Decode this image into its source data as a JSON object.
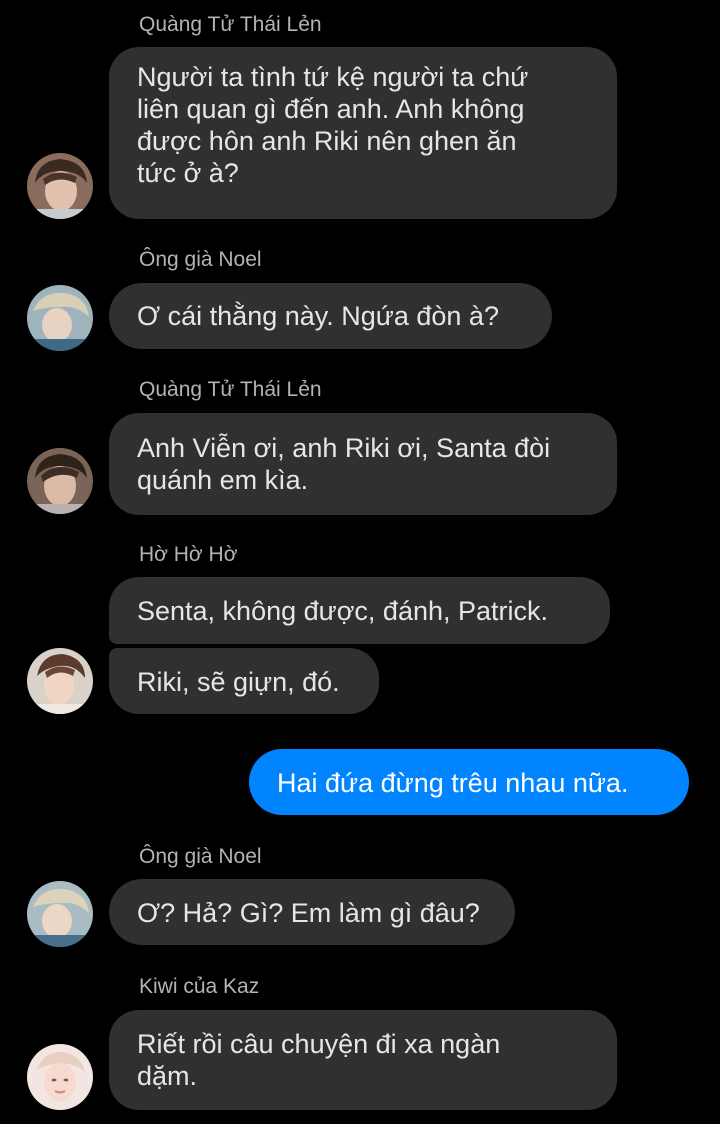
{
  "colors": {
    "background": "#000000",
    "incoming_bubble": "#303030",
    "outgoing_bubble": "#0084ff",
    "sender_name": "#b0b3b8",
    "message_text": "#e4e6eb"
  },
  "messages": [
    {
      "sender": "Quàng Tử Thái Lẻn",
      "text": "Người ta tình tứ kệ người ta chứ\nliên quan gì đến anh. Anh không\nđược hôn anh Riki nên ghen ăn\ntức ở à?",
      "avatar": "avatar-thai"
    },
    {
      "sender": "Ông già Noel",
      "text": "Ơ cái thằng này. Ngứa đòn à?",
      "avatar": "avatar-noel"
    },
    {
      "sender": "Quàng Tử Thái Lẻn",
      "text": "Anh Viễn ơi, anh Riki ơi, Santa đòi\nquánh em kìa.",
      "avatar": "avatar-thai"
    },
    {
      "sender": "Hờ Hờ Hờ",
      "text": "Senta, không được, đánh, Patrick.",
      "avatar": ""
    },
    {
      "sender": "",
      "text": "Riki, sẽ giựn, đó.",
      "avatar": "avatar-ho"
    },
    {
      "sender": "",
      "text": "Hai đứa đừng trêu nhau nữa.",
      "avatar": "",
      "outgoing": true
    },
    {
      "sender": "Ông già Noel",
      "text": "Ơ? Hả? Gì? Em làm gì đâu?",
      "avatar": "avatar-noel"
    },
    {
      "sender": "Kiwi của Kaz",
      "text": "Riết rồi câu chuyện đi xa ngàn\ndặm.",
      "avatar": "avatar-kiwi"
    }
  ]
}
